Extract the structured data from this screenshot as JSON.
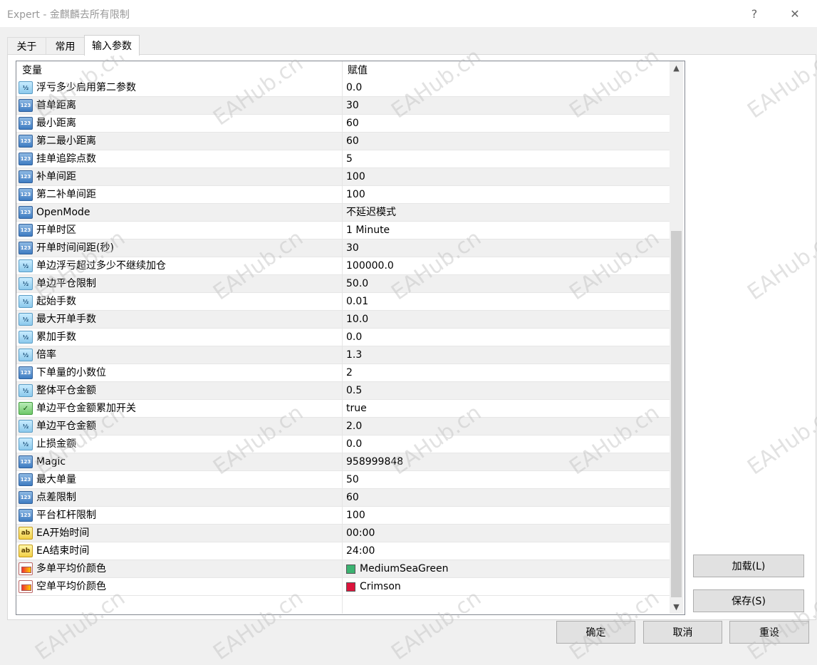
{
  "window": {
    "title": "Expert - 金麒麟去所有限制",
    "help": "?",
    "close": "✕"
  },
  "tabs": [
    {
      "label": "关于"
    },
    {
      "label": "常用"
    },
    {
      "label": "输入参数"
    }
  ],
  "grid": {
    "col_name": "变量",
    "col_value": "赋值",
    "rows": [
      {
        "type": "double",
        "name": "浮亏多少启用第二参数",
        "value": "0.0"
      },
      {
        "type": "int",
        "name": "首单距离",
        "value": "30"
      },
      {
        "type": "int",
        "name": "最小距离",
        "value": "60"
      },
      {
        "type": "int",
        "name": "第二最小距离",
        "value": "60"
      },
      {
        "type": "int",
        "name": "挂单追踪点数",
        "value": "5"
      },
      {
        "type": "int",
        "name": "补单间距",
        "value": "100"
      },
      {
        "type": "int",
        "name": "第二补单间距",
        "value": "100"
      },
      {
        "type": "int",
        "name": "OpenMode",
        "value": "不延迟模式"
      },
      {
        "type": "int",
        "name": "开单时区",
        "value": "1 Minute"
      },
      {
        "type": "int",
        "name": "开单时间间距(秒)",
        "value": "30"
      },
      {
        "type": "double",
        "name": "单边浮亏超过多少不继续加仓",
        "value": "100000.0"
      },
      {
        "type": "double",
        "name": "单边平仓限制",
        "value": "50.0"
      },
      {
        "type": "double",
        "name": "起始手数",
        "value": "0.01"
      },
      {
        "type": "double",
        "name": "最大开单手数",
        "value": "10.0"
      },
      {
        "type": "double",
        "name": "累加手数",
        "value": "0.0"
      },
      {
        "type": "double",
        "name": "倍率",
        "value": "1.3"
      },
      {
        "type": "int",
        "name": "下单量的小数位",
        "value": "2"
      },
      {
        "type": "double",
        "name": "整体平仓金额",
        "value": "0.5"
      },
      {
        "type": "bool",
        "name": "单边平仓金额累加开关",
        "value": "true"
      },
      {
        "type": "double",
        "name": "单边平仓金额",
        "value": "2.0"
      },
      {
        "type": "double",
        "name": "止损金额",
        "value": "0.0"
      },
      {
        "type": "int",
        "name": "Magic",
        "value": "958999848"
      },
      {
        "type": "int",
        "name": "最大单量",
        "value": "50"
      },
      {
        "type": "int",
        "name": "点差限制",
        "value": "60"
      },
      {
        "type": "int",
        "name": "平台杠杆限制",
        "value": "100"
      },
      {
        "type": "string",
        "name": "EA开始时间",
        "value": "00:00"
      },
      {
        "type": "string",
        "name": "EA结束时间",
        "value": "24:00"
      },
      {
        "type": "color",
        "name": "多单平均价颜色",
        "value": "MediumSeaGreen",
        "color": "#3cb371"
      },
      {
        "type": "color",
        "name": "空单平均价颜色",
        "value": "Crimson",
        "color": "#dc143c"
      }
    ]
  },
  "icons": {
    "int": "123",
    "double": "½",
    "bool": "✓",
    "string": "ab"
  },
  "buttons": {
    "load": "加载(L)",
    "save": "保存(S)",
    "ok": "确定",
    "cancel": "取消",
    "reset": "重设"
  },
  "watermark": "EAHub.cn"
}
